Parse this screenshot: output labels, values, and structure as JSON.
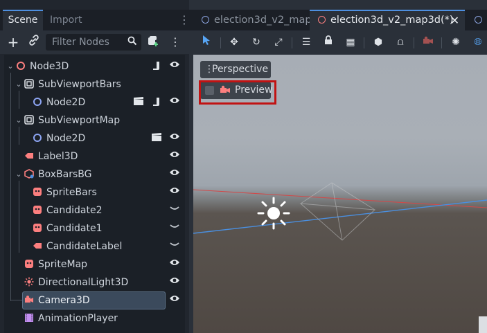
{
  "dock": {
    "tabs": [
      "Scene",
      "Import"
    ],
    "filter_placeholder": "Filter Nodes"
  },
  "tree": [
    {
      "label": "Node3D",
      "icon": "node3d-icon"
    },
    {
      "label": "SubViewportBars",
      "icon": "subviewport-icon"
    },
    {
      "label": "Node2D",
      "icon": "node2d-icon"
    },
    {
      "label": "SubViewportMap",
      "icon": "subviewport-icon"
    },
    {
      "label": "Node2D",
      "icon": "node2d-icon"
    },
    {
      "label": "Label3D",
      "icon": "label3d-icon"
    },
    {
      "label": "BoxBarsBG",
      "icon": "csgbox-icon"
    },
    {
      "label": "SpriteBars",
      "icon": "sprite-icon"
    },
    {
      "label": "Candidate2",
      "icon": "sprite-icon"
    },
    {
      "label": "Candidate1",
      "icon": "sprite-icon"
    },
    {
      "label": "CandidateLabel",
      "icon": "label3d-icon"
    },
    {
      "label": "SpriteMap",
      "icon": "sprite-icon"
    },
    {
      "label": "DirectionalLight3D",
      "icon": "light-icon"
    },
    {
      "label": "Camera3D",
      "icon": "camera-icon",
      "selected": true
    },
    {
      "label": "AnimationPlayer",
      "icon": "animation-icon"
    }
  ],
  "editor": {
    "tabs": [
      "election3d_v2_map",
      "election3d_v2_map3d(*)"
    ],
    "active_tab": "election3d_v2_map3d(*)"
  },
  "viewport": {
    "perspective_label": "Perspective",
    "preview_label": "Preview"
  },
  "colors": {
    "accent": "#4d8fe0",
    "highlight": "#c11313",
    "node3d": "#fc7f7f",
    "node2d": "#8da5f3"
  }
}
